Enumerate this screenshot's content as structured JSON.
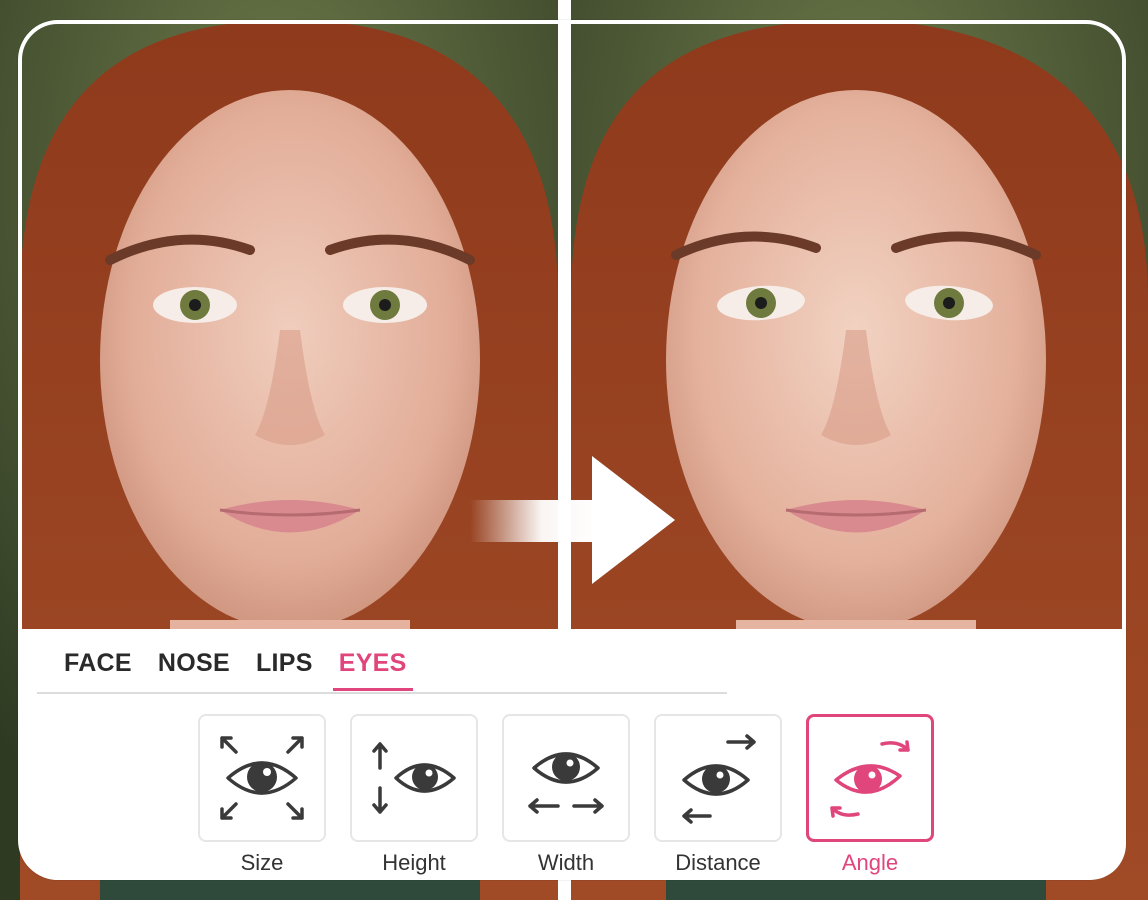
{
  "colors": {
    "accent": "#e0457b",
    "icon": "#3a3a3a",
    "tab_text": "#2a2a2a",
    "panel_bg": "#ffffff"
  },
  "photos": {
    "before": {
      "label": "before-photo"
    },
    "after": {
      "label": "after-photo"
    }
  },
  "tabs": [
    {
      "label": "FACE",
      "active": false
    },
    {
      "label": "NOSE",
      "active": false
    },
    {
      "label": "LIPS",
      "active": false
    },
    {
      "label": "EYES",
      "active": true
    }
  ],
  "tools": [
    {
      "label": "Size",
      "icon": "eye-size-icon",
      "active": false
    },
    {
      "label": "Height",
      "icon": "eye-height-icon",
      "active": false
    },
    {
      "label": "Width",
      "icon": "eye-width-icon",
      "active": false
    },
    {
      "label": "Distance",
      "icon": "eye-distance-icon",
      "active": false
    },
    {
      "label": "Angle",
      "icon": "eye-angle-icon",
      "active": true
    }
  ]
}
